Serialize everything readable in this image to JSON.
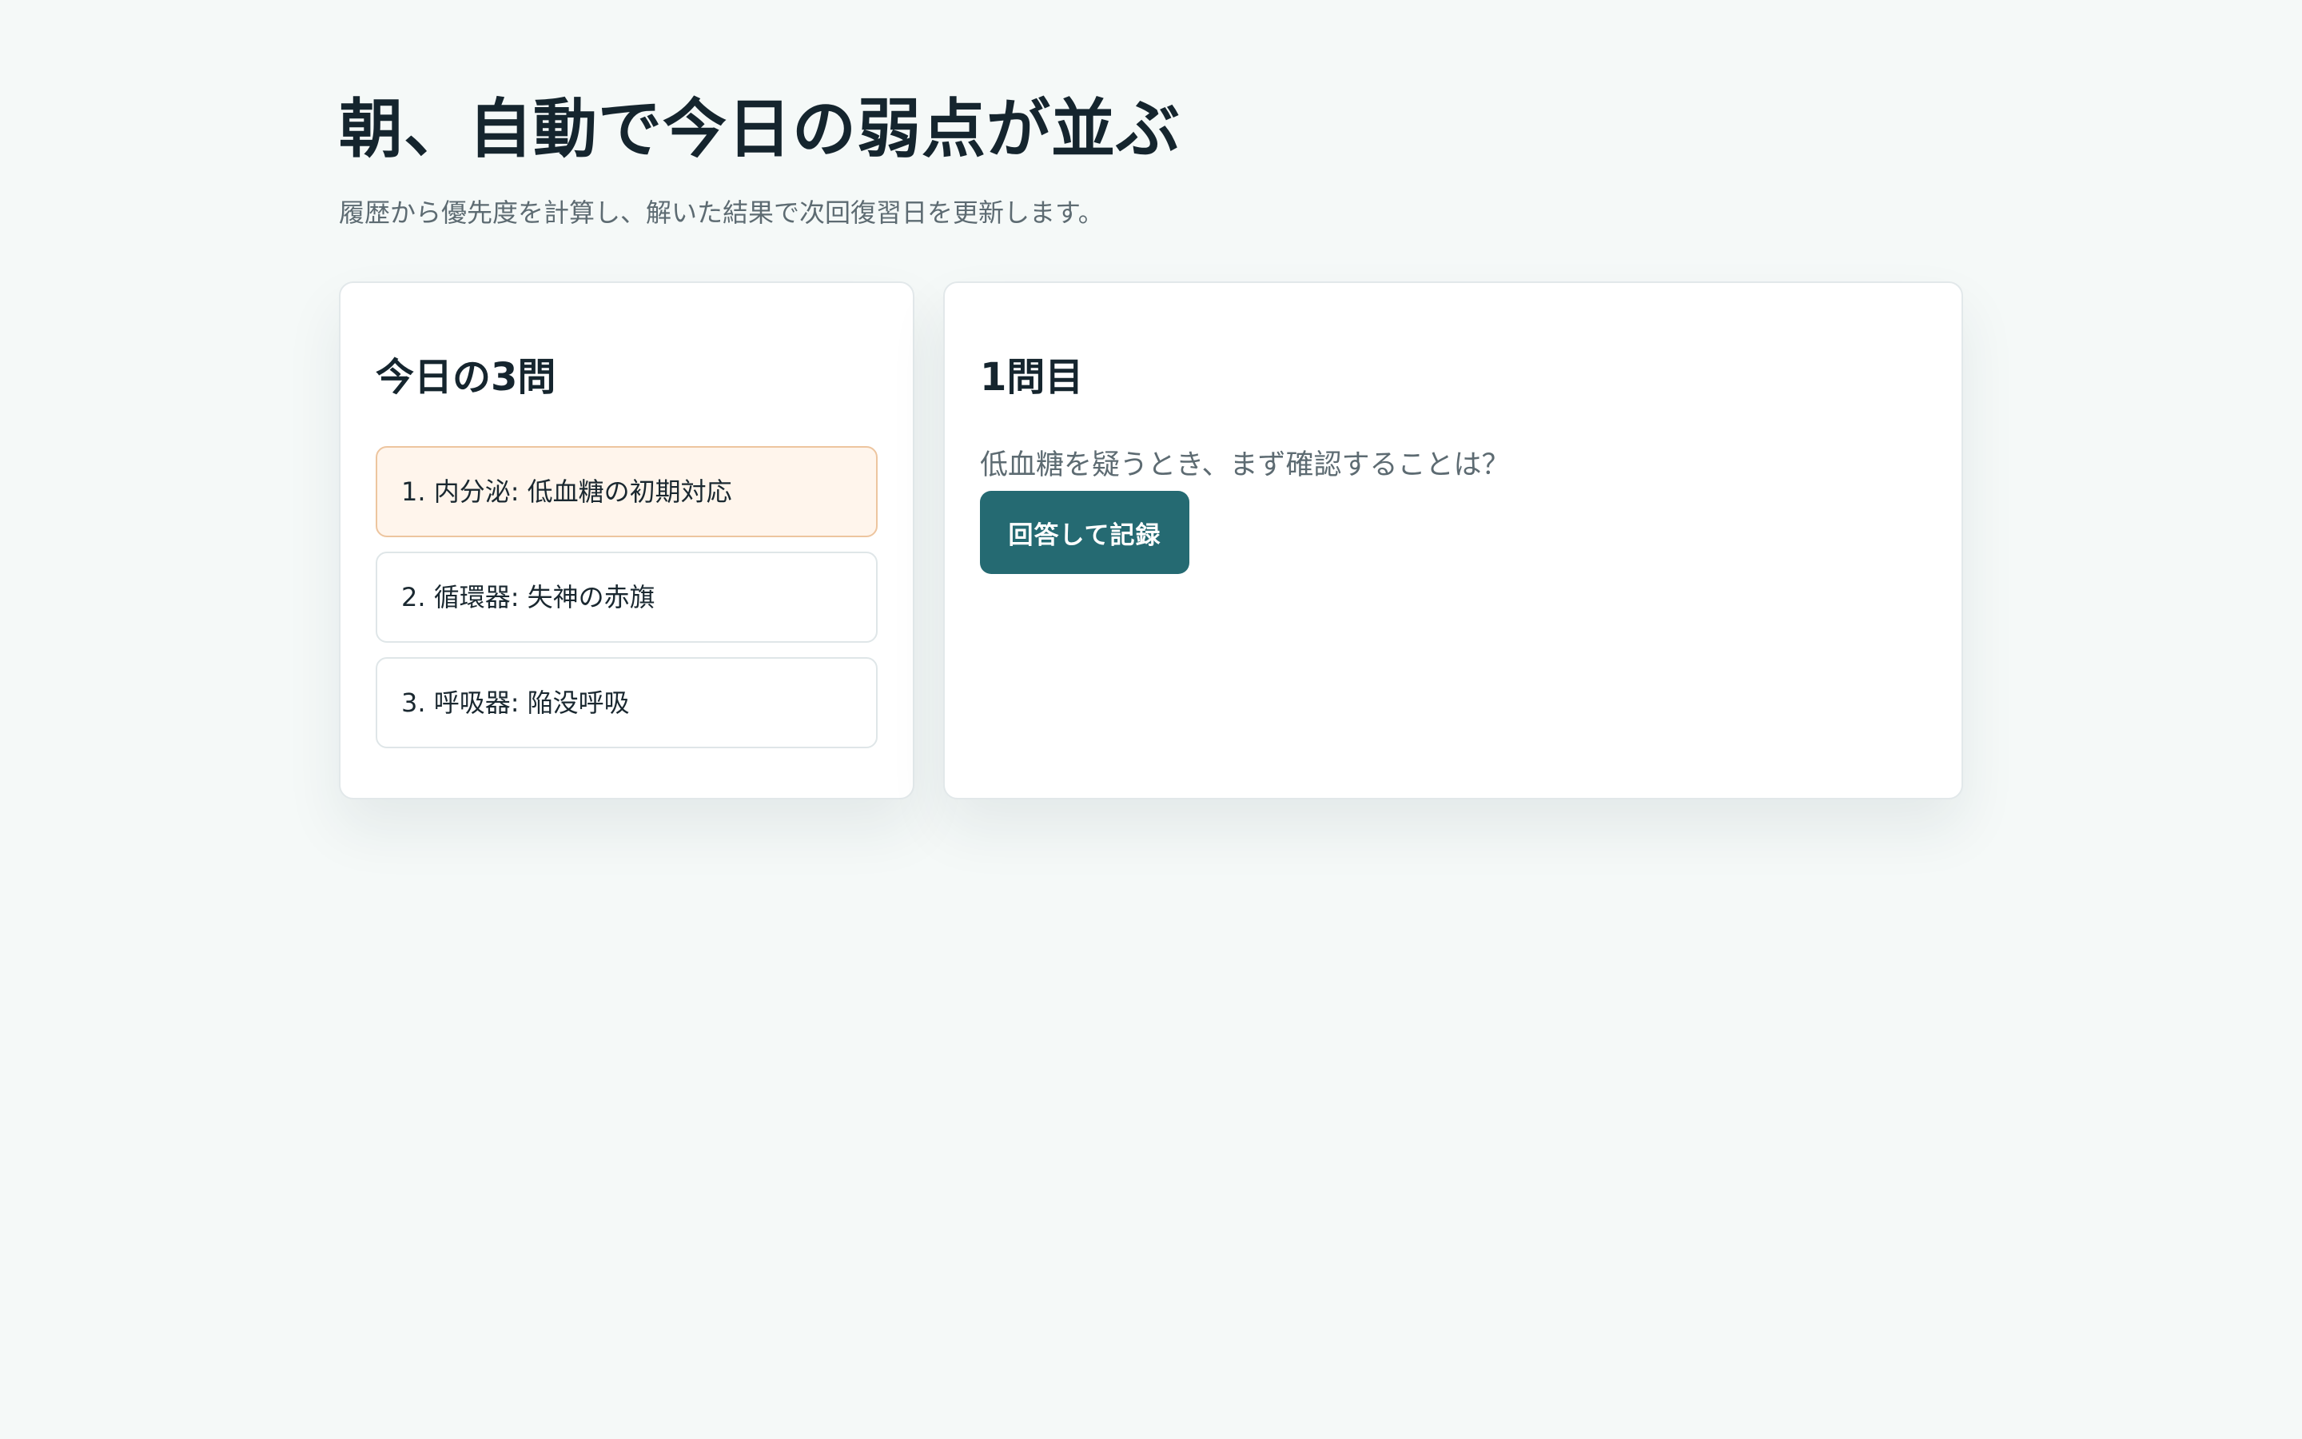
{
  "header": {
    "title": "朝、自動で今日の弱点が並ぶ",
    "subtitle": "履歴から優先度を計算し、解いた結果で次回復習日を更新します。"
  },
  "today_panel": {
    "title": "今日の3問",
    "items": [
      {
        "label": "1. 内分泌: 低血糖の初期対応",
        "active": true
      },
      {
        "label": "2. 循環器: 失神の赤旗",
        "active": false
      },
      {
        "label": "3. 呼吸器: 陥没呼吸",
        "active": false
      }
    ]
  },
  "question_panel": {
    "title": "1問目",
    "question": "低血糖を疑うとき、まず確認することは？",
    "record_button_label": "回答して記録"
  },
  "colors": {
    "background": "#f5f9f8",
    "accent": "#256a72",
    "active_item_bg": "#fff5ec",
    "active_item_border": "#edc59f",
    "heading": "#15252e",
    "muted": "#5d6b72"
  }
}
